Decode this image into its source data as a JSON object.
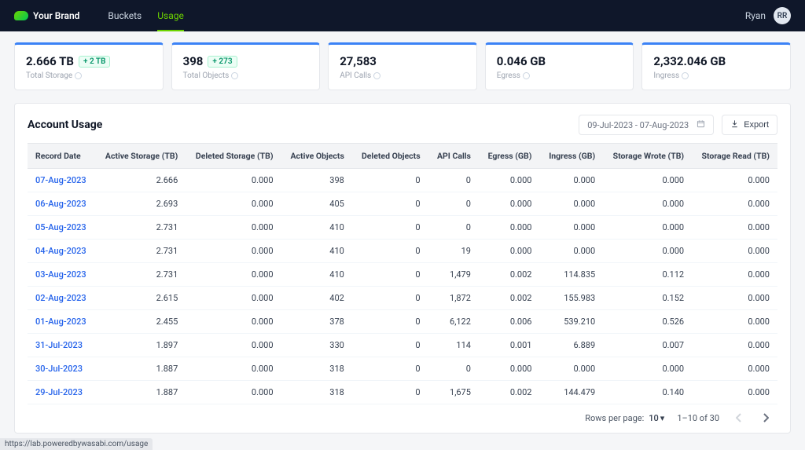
{
  "nav": {
    "brand": "Your Brand",
    "links": [
      {
        "label": "Buckets",
        "active": false
      },
      {
        "label": "Usage",
        "active": true
      }
    ],
    "user": "Ryan",
    "avatar": "RR"
  },
  "stats": [
    {
      "value": "2.666 TB",
      "delta": "+ 2 TB",
      "label": "Total Storage"
    },
    {
      "value": "398",
      "delta": "+ 273",
      "label": "Total Objects"
    },
    {
      "value": "27,583",
      "label": "API Calls"
    },
    {
      "value": "0.046 GB",
      "label": "Egress"
    },
    {
      "value": "2,332.046 GB",
      "label": "Ingress"
    }
  ],
  "panel": {
    "title": "Account Usage",
    "date_range": "09-Jul-2023 - 07-Aug-2023",
    "export_label": "Export"
  },
  "columns": [
    "Record Date",
    "Active Storage (TB)",
    "Deleted Storage (TB)",
    "Active Objects",
    "Deleted Objects",
    "API Calls",
    "Egress (GB)",
    "Ingress (GB)",
    "Storage Wrote (TB)",
    "Storage Read (TB)"
  ],
  "rows": [
    {
      "date": "07-Aug-2023",
      "active_storage": "2.666",
      "deleted_storage": "0.000",
      "active_objects": "398",
      "deleted_objects": "0",
      "api_calls": "0",
      "egress": "0.000",
      "ingress": "0.000",
      "wrote": "0.000",
      "read": "0.000"
    },
    {
      "date": "06-Aug-2023",
      "active_storage": "2.693",
      "deleted_storage": "0.000",
      "active_objects": "405",
      "deleted_objects": "0",
      "api_calls": "0",
      "egress": "0.000",
      "ingress": "0.000",
      "wrote": "0.000",
      "read": "0.000"
    },
    {
      "date": "05-Aug-2023",
      "active_storage": "2.731",
      "deleted_storage": "0.000",
      "active_objects": "410",
      "deleted_objects": "0",
      "api_calls": "0",
      "egress": "0.000",
      "ingress": "0.000",
      "wrote": "0.000",
      "read": "0.000"
    },
    {
      "date": "04-Aug-2023",
      "active_storage": "2.731",
      "deleted_storage": "0.000",
      "active_objects": "410",
      "deleted_objects": "0",
      "api_calls": "19",
      "egress": "0.000",
      "ingress": "0.000",
      "wrote": "0.000",
      "read": "0.000"
    },
    {
      "date": "03-Aug-2023",
      "active_storage": "2.731",
      "deleted_storage": "0.000",
      "active_objects": "410",
      "deleted_objects": "0",
      "api_calls": "1,479",
      "egress": "0.002",
      "ingress": "114.835",
      "wrote": "0.112",
      "read": "0.000"
    },
    {
      "date": "02-Aug-2023",
      "active_storage": "2.615",
      "deleted_storage": "0.000",
      "active_objects": "402",
      "deleted_objects": "0",
      "api_calls": "1,872",
      "egress": "0.002",
      "ingress": "155.983",
      "wrote": "0.152",
      "read": "0.000"
    },
    {
      "date": "01-Aug-2023",
      "active_storage": "2.455",
      "deleted_storage": "0.000",
      "active_objects": "378",
      "deleted_objects": "0",
      "api_calls": "6,122",
      "egress": "0.006",
      "ingress": "539.210",
      "wrote": "0.526",
      "read": "0.000"
    },
    {
      "date": "31-Jul-2023",
      "active_storage": "1.897",
      "deleted_storage": "0.000",
      "active_objects": "330",
      "deleted_objects": "0",
      "api_calls": "114",
      "egress": "0.001",
      "ingress": "6.889",
      "wrote": "0.007",
      "read": "0.000"
    },
    {
      "date": "30-Jul-2023",
      "active_storage": "1.887",
      "deleted_storage": "0.000",
      "active_objects": "318",
      "deleted_objects": "0",
      "api_calls": "0",
      "egress": "0.000",
      "ingress": "0.000",
      "wrote": "0.000",
      "read": "0.000"
    },
    {
      "date": "29-Jul-2023",
      "active_storage": "1.887",
      "deleted_storage": "0.000",
      "active_objects": "318",
      "deleted_objects": "0",
      "api_calls": "1,675",
      "egress": "0.002",
      "ingress": "144.479",
      "wrote": "0.140",
      "read": "0.000"
    }
  ],
  "footer": {
    "rows_per_page_label": "Rows per page:",
    "rows_per_page_value": "10",
    "range": "1–10 of 30"
  },
  "status_url": "https://lab.poweredbywasabi.com/usage"
}
